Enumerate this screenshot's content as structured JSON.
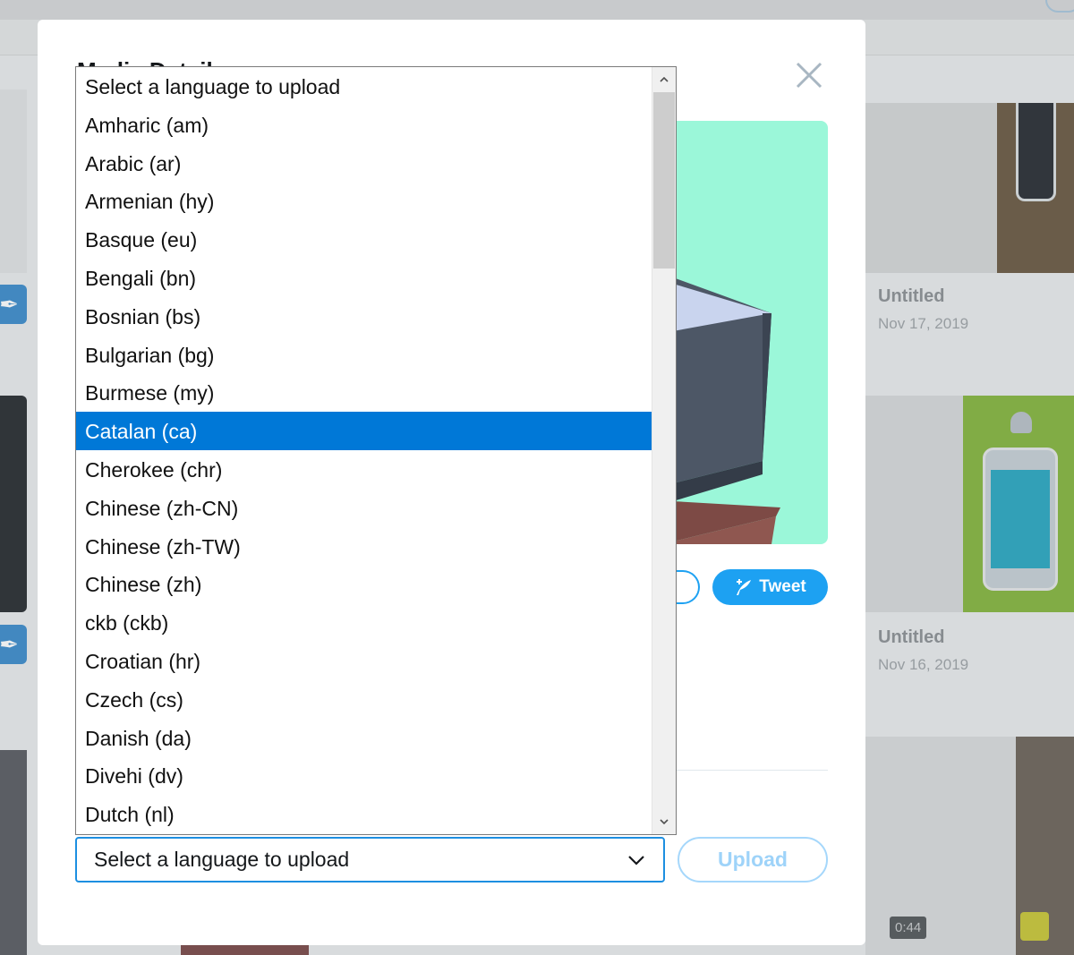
{
  "modal": {
    "title": "Media Details",
    "tweet_label": "Tweet",
    "upload_label": "Upload",
    "select_value": "Select a language to upload"
  },
  "dropdown": {
    "options": [
      "Select a language to upload",
      "Amharic (am)",
      "Arabic (ar)",
      "Armenian (hy)",
      "Basque (eu)",
      "Bengali (bn)",
      "Bosnian (bs)",
      "Bulgarian (bg)",
      "Burmese (my)",
      "Catalan (ca)",
      "Cherokee (chr)",
      "Chinese (zh-CN)",
      "Chinese (zh-TW)",
      "Chinese (zh)",
      "ckb (ckb)",
      "Croatian (hr)",
      "Czech (cs)",
      "Danish (da)",
      "Divehi (dv)",
      "Dutch (nl)"
    ],
    "selected": "Catalan (ca)"
  },
  "background": {
    "tiles": [
      {
        "title": "Untitled",
        "date": "Nov 17, 2019"
      },
      {
        "title": "Untitled",
        "date": "Nov 16, 2019"
      }
    ],
    "video_duration": "0:44"
  },
  "colors": {
    "accent": "#1da1f2",
    "selected_option": "#0078d7",
    "preview_bg": "#9bf7d9"
  }
}
